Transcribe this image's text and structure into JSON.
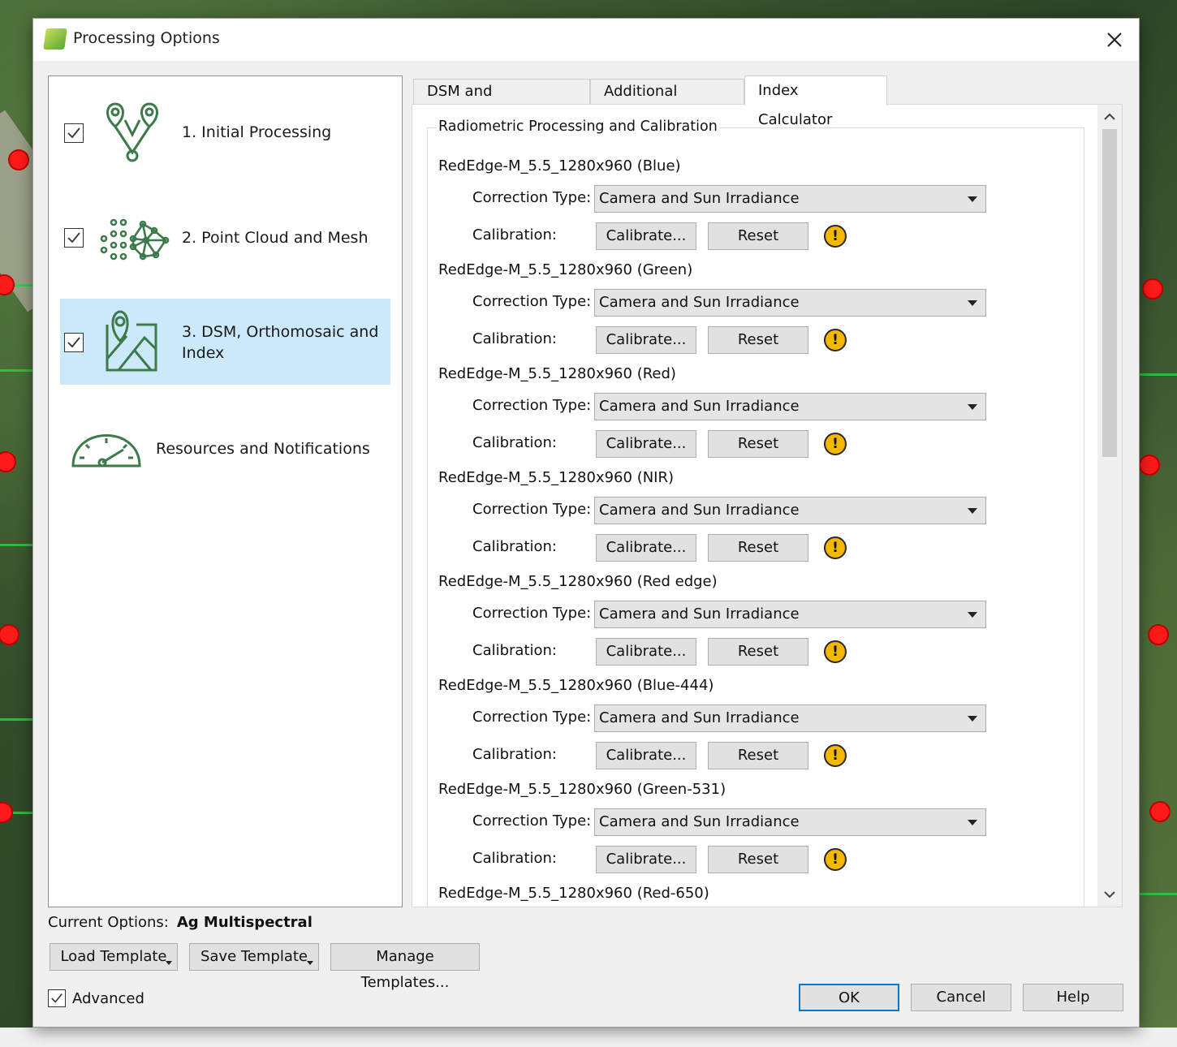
{
  "window": {
    "title": "Processing Options",
    "close_glyph": "✕"
  },
  "nav": {
    "items": [
      {
        "label": "1. Initial Processing",
        "checked": true,
        "icon": "initial-processing-icon"
      },
      {
        "label": "2. Point Cloud and Mesh",
        "checked": true,
        "icon": "point-cloud-icon"
      },
      {
        "label": "3. DSM, Orthomosaic and Index",
        "checked": true,
        "icon": "map-marker-icon",
        "active": true
      },
      {
        "label": "Resources and Notifications",
        "icon": "gauge-icon"
      }
    ]
  },
  "tabs": [
    {
      "label": "DSM and Orthomosaic"
    },
    {
      "label": "Additional Outputs"
    },
    {
      "label": "Index Calculator",
      "active": true
    }
  ],
  "radiometric": {
    "group_title": "Radiometric Processing and Calibration",
    "correction_label": "Correction Type:",
    "calibration_label": "Calibration:",
    "calibrate_label": "Calibrate...",
    "reset_label": "Reset",
    "warn_glyph": "!",
    "cameras": [
      {
        "name": "RedEdge-M_5.5_1280x960 (Blue)",
        "correction": "Camera and Sun Irradiance"
      },
      {
        "name": "RedEdge-M_5.5_1280x960 (Green)",
        "correction": "Camera and Sun Irradiance"
      },
      {
        "name": "RedEdge-M_5.5_1280x960 (Red)",
        "correction": "Camera and Sun Irradiance"
      },
      {
        "name": "RedEdge-M_5.5_1280x960 (NIR)",
        "correction": "Camera and Sun Irradiance"
      },
      {
        "name": "RedEdge-M_5.5_1280x960 (Red edge)",
        "correction": "Camera and Sun Irradiance"
      },
      {
        "name": "RedEdge-M_5.5_1280x960 (Blue-444)",
        "correction": "Camera and Sun Irradiance"
      },
      {
        "name": "RedEdge-M_5.5_1280x960 (Green-531)",
        "correction": "Camera and Sun Irradiance"
      },
      {
        "name": "RedEdge-M_5.5_1280x960 (Red-650)",
        "correction": ""
      }
    ]
  },
  "footer": {
    "current_options_label": "Current Options:",
    "current_options_value": "Ag Multispectral",
    "load_template": "Load Template",
    "save_template": "Save Template",
    "manage_templates": "Manage Templates...",
    "advanced_label": "Advanced",
    "advanced_checked": true,
    "ok": "OK",
    "cancel": "Cancel",
    "help": "Help"
  },
  "colors": {
    "accent": "#0078d7",
    "nav_active": "#cce8fb",
    "icon_green": "#3d7a4a",
    "warning": "#f3b800"
  }
}
